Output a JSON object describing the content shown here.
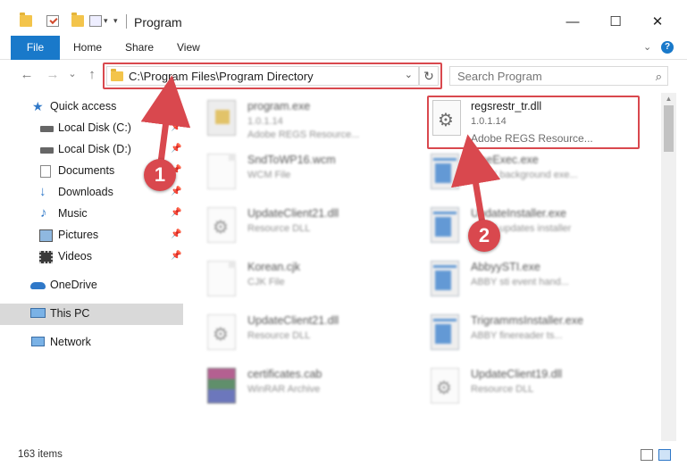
{
  "window": {
    "title": "Program",
    "minimize": "—",
    "maximize": "☐",
    "close": "✕"
  },
  "ribbon": {
    "tabs": [
      "File",
      "Home",
      "Share",
      "View"
    ],
    "help": "?"
  },
  "navigation": {
    "back": "←",
    "forward": "→",
    "recent": "⌄",
    "up": "↑",
    "address": "C:\\Program Files\\Program Directory",
    "refresh": "↻",
    "search_placeholder": "Search Program",
    "search_icon": "⌕"
  },
  "sidebar": {
    "items": [
      {
        "label": "Quick access",
        "icon": "star-icon"
      },
      {
        "label": "Local Disk (C:)",
        "icon": "drive-icon"
      },
      {
        "label": "Local Disk (D:)",
        "icon": "drive-icon"
      },
      {
        "label": "Documents",
        "icon": "documents-icon"
      },
      {
        "label": "Downloads",
        "icon": "downloads-icon"
      },
      {
        "label": "Music",
        "icon": "music-icon"
      },
      {
        "label": "Pictures",
        "icon": "pictures-icon"
      },
      {
        "label": "Videos",
        "icon": "videos-icon"
      },
      {
        "label": "OneDrive",
        "icon": "onedrive-icon"
      },
      {
        "label": "This PC",
        "icon": "this-pc-icon"
      },
      {
        "label": "Network",
        "icon": "network-icon"
      }
    ]
  },
  "files": [
    {
      "name": "program.exe",
      "line2": "1.0.1.14",
      "line3": "Adobe REGS Resource..."
    },
    {
      "name": "regsrestr_tr.dll",
      "line2": "1.0.1.14",
      "line3": "Adobe REGS Resource..."
    },
    {
      "name": "SndToWP16.wcm",
      "line2": "WCM File",
      "line3": ""
    },
    {
      "name": "FineExec.exe",
      "line2": "ABBY background exe...",
      "line3": ""
    },
    {
      "name": "UpdateClient21.dll",
      "line2": "Resource DLL",
      "line3": ""
    },
    {
      "name": "UpdateInstaller.exe",
      "line2": "ABBY updates installer",
      "line3": ""
    },
    {
      "name": "Korean.cjk",
      "line2": "CJK File",
      "line3": ""
    },
    {
      "name": "AbbyySTI.exe",
      "line2": "ABBY sti event hand...",
      "line3": ""
    },
    {
      "name": "UpdateClient21.dll",
      "line2": "Resource DLL",
      "line3": ""
    },
    {
      "name": "TrigrammsInstaller.exe",
      "line2": "ABBY finereader ts...",
      "line3": ""
    },
    {
      "name": "certificates.cab",
      "line2": "WinRAR Archive",
      "line3": ""
    },
    {
      "name": "UpdateClient19.dll",
      "line2": "Resource DLL",
      "line3": ""
    }
  ],
  "status": {
    "item_count": "163 items"
  },
  "annotations": {
    "step1": "1",
    "step2": "2",
    "color": "#d9484e"
  }
}
